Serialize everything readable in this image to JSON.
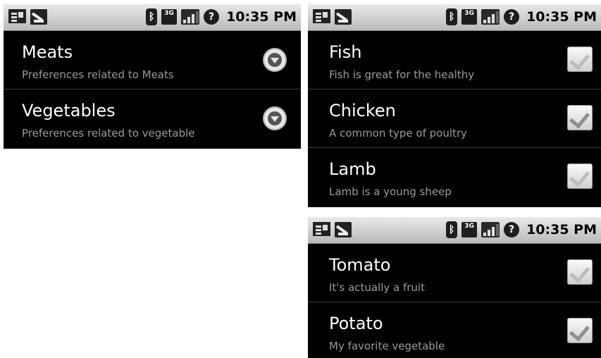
{
  "status_bar": {
    "time": "10:35 PM",
    "icon_3g": "3G",
    "icon_help": "?"
  },
  "screen_categories": {
    "items": [
      {
        "title": "Meats",
        "summary": "Preferences related to Meats"
      },
      {
        "title": "Vegetables",
        "summary": "Preferences related to vegetable"
      }
    ]
  },
  "screen_meats": {
    "items": [
      {
        "title": "Fish",
        "summary": "Fish is great for the healthy",
        "checked": false
      },
      {
        "title": "Chicken",
        "summary": "A common type of poultry",
        "checked": true
      },
      {
        "title": "Lamb",
        "summary": "Lamb is a young sheep",
        "checked": false
      }
    ]
  },
  "screen_vegetables": {
    "items": [
      {
        "title": "Tomato",
        "summary": "It's actually a fruit",
        "checked": false
      },
      {
        "title": "Potato",
        "summary": "My favorite vegetable",
        "checked": true
      }
    ]
  }
}
